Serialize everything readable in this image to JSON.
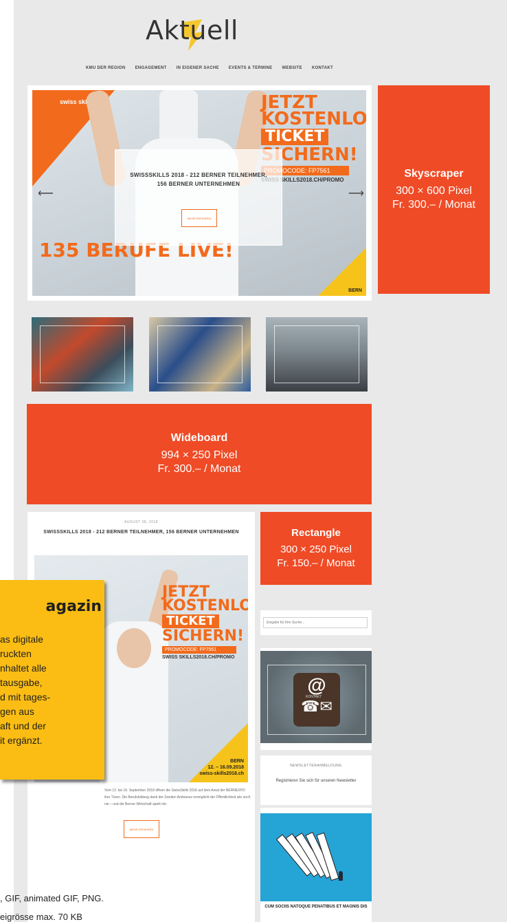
{
  "header": {
    "logo_text": "Aktuell",
    "nav": [
      "KMU DER REGION",
      "ENGAGEMENT",
      "IN EIGENER SACHE",
      "EVENTS & TERMINE",
      "WEBSITE",
      "KONTAKT"
    ]
  },
  "hero": {
    "brand": "swiss skills",
    "promo_line1": "JETZT",
    "promo_line2": "KOSTENLOS",
    "promo_ticket": "TICKET",
    "promo_line4": "SICHERN!",
    "promo_code": "PROMOCODE: FP7561",
    "promo_sub": "SWISS SKILLS2018.CH/PROMO",
    "overlay_title": "SWISSSKILLS 2018 - 212 BERNER TEILNEHMER, 156 BERNER UNTERNEHMEN",
    "overlay_button": "MEHR ERFAHREN",
    "berufe": "135 BERUFE LIVE!",
    "corner_label": "BERN",
    "arrow_left": "⟵",
    "arrow_right": "⟶"
  },
  "ads": {
    "skyscraper": {
      "title": "Skyscraper",
      "size": "300 × 600 Pixel",
      "price": "Fr. 300.– / Monat"
    },
    "wideboard": {
      "title": "Wideboard",
      "size": "994 × 250 Pixel",
      "price": "Fr. 300.– / Monat"
    },
    "rectangle": {
      "title": "Rectangle",
      "size": "300 × 250 Pixel",
      "price": "Fr. 150.– / Monat"
    }
  },
  "article": {
    "date": "AUGUST 08, 2018",
    "title": "SWISSSKILLS 2018 - 212 BERNER TEILNEHMER, 156 BERNER UNTERNEHMEN",
    "dates_line1": "BERN",
    "dates_line2": "12. – 16.09.2018",
    "dates_line3": "swiss-skills2018.ch",
    "text": "Vom 12. bis 16. September 2018 öffnen die SwissSkills 2018 auf dem Areal der BERNEXPO ihre Türen. Die Berufsbildung dank der Zweiten Ambiance ermöglicht der Öffentlichkeit wie noch nie – und die Berner Wirtschaft spielt mit.",
    "more_button": "MEHR ERFAHREN"
  },
  "magazin": {
    "title": "agazin",
    "lines": [
      "as digitale",
      "ruckten",
      "nhaltet alle",
      "tausgabe,",
      "d mit tages-",
      "gen aus",
      "aft und der",
      "it ergänzt."
    ]
  },
  "sidebar": {
    "search_placeholder": "Eingabe für Ihre Suche...",
    "contact_label": "KONTAKT",
    "newsletter_head": "NEWSLETTERANMELDUNG",
    "newsletter_text": "Registrieren Sie sich für unseren Newsletter",
    "domino_caption": "CUM SOCIIS NATOQUE PENATIBUS ET MAGNIS DIS"
  },
  "footer": {
    "line1": ", GIF, animated GIF, PNG.",
    "line2": "eigrösse max. 70 KB"
  }
}
